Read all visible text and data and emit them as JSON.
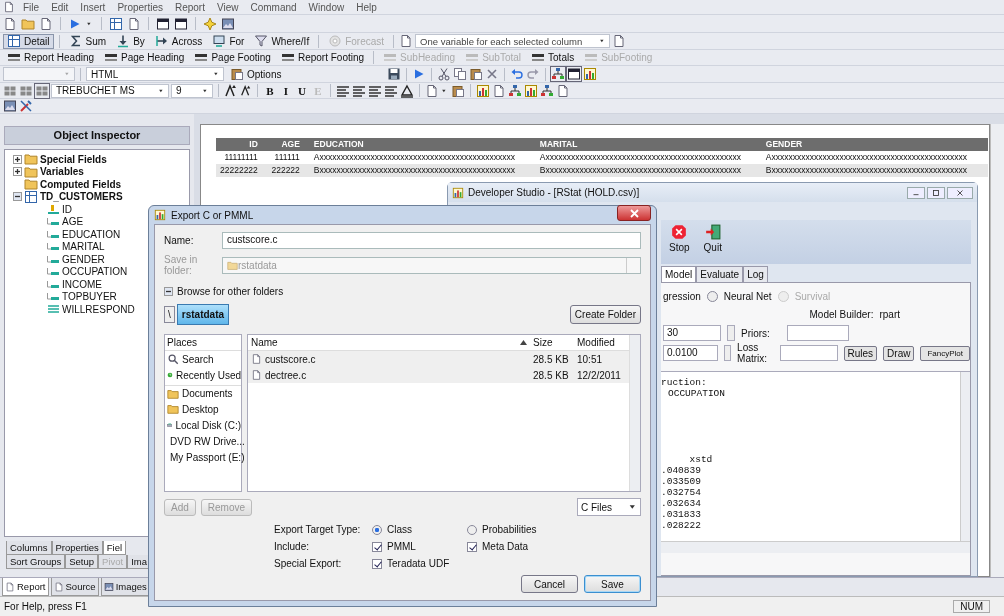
{
  "menu": [
    "File",
    "Edit",
    "Insert",
    "Properties",
    "Report",
    "View",
    "Command",
    "Window",
    "Help"
  ],
  "report_tools": [
    {
      "label": "Detail",
      "selected": true,
      "disabled": false
    },
    {
      "label": "Sum",
      "selected": false,
      "disabled": false
    },
    {
      "label": "By",
      "selected": false,
      "disabled": false
    },
    {
      "label": "Across",
      "selected": false,
      "disabled": false
    },
    {
      "label": "For",
      "selected": false,
      "disabled": false
    },
    {
      "label": "Where/If",
      "selected": false,
      "disabled": false
    },
    {
      "label": "Forecast",
      "selected": false,
      "disabled": true
    }
  ],
  "column_mode": "One variable for each selected column",
  "sections": [
    {
      "label": "Report Heading",
      "disabled": false
    },
    {
      "label": "Page Heading",
      "disabled": false
    },
    {
      "label": "Page Footing",
      "disabled": false
    },
    {
      "label": "Report Footing",
      "disabled": false
    },
    {
      "label": "SubHeading",
      "disabled": true
    },
    {
      "label": "SubTotal",
      "disabled": true
    },
    {
      "label": "Totals",
      "disabled": false
    },
    {
      "label": "SubFooting",
      "disabled": true
    }
  ],
  "output_format": "HTML",
  "options_button": "Options",
  "font": "TREBUCHET MS",
  "font_size": "9",
  "style_buttons": [
    {
      "label": "B",
      "disabled": false
    },
    {
      "label": "I",
      "disabled": false
    },
    {
      "label": "U",
      "disabled": false
    },
    {
      "label": "E",
      "disabled": true
    }
  ],
  "object_inspector": {
    "title": "Object Inspector",
    "tree": [
      {
        "label": "Special Fields",
        "kind": "folder",
        "has_toggle": true,
        "expanded": false
      },
      {
        "label": "Variables",
        "kind": "folder",
        "has_toggle": true,
        "expanded": false
      },
      {
        "label": "Computed Fields",
        "kind": "folder",
        "has_toggle": false
      },
      {
        "label": "TD_CUSTOMERS",
        "kind": "table",
        "has_toggle": true,
        "expanded": true,
        "children": [
          {
            "label": "ID",
            "kind": "key"
          },
          {
            "label": "AGE",
            "kind": "field"
          },
          {
            "label": "EDUCATION",
            "kind": "field"
          },
          {
            "label": "MARITAL",
            "kind": "field"
          },
          {
            "label": "GENDER",
            "kind": "field"
          },
          {
            "label": "OCCUPATION",
            "kind": "field"
          },
          {
            "label": "INCOME",
            "kind": "field"
          },
          {
            "label": "TOPBUYER",
            "kind": "field"
          },
          {
            "label": "WILLRESPOND",
            "kind": "computed"
          }
        ]
      }
    ],
    "tabs_row_1": [
      {
        "label": "Columns",
        "selected": false,
        "disabled": false
      },
      {
        "label": "Properties",
        "selected": false,
        "disabled": false
      },
      {
        "label": "Fiel",
        "selected": true,
        "disabled": false
      }
    ],
    "tabs_row_2": [
      {
        "label": "Sort Groups",
        "selected": false,
        "disabled": false
      },
      {
        "label": "Setup",
        "selected": false,
        "disabled": false
      },
      {
        "label": "Pivot",
        "selected": false,
        "disabled": true
      },
      {
        "label": "Ima",
        "selected": false,
        "disabled": false
      }
    ]
  },
  "report": {
    "columns": [
      "ID",
      "AGE",
      "EDUCATION",
      "MARITAL",
      "GENDER"
    ],
    "rows": [
      [
        "11111111",
        "111111",
        "Axxxxxxxxxxxxxxxxxxxxxxxxxxxxxxxxxxxxxxxxxxxxxx",
        "Axxxxxxxxxxxxxxxxxxxxxxxxxxxxxxxxxxxxxxxxxxxxxx",
        "Axxxxxxxxxxxxxxxxxxxxxxxxxxxxxxxxxxxxxxxxxxxxxx"
      ],
      [
        "22222222",
        "222222",
        "Bxxxxxxxxxxxxxxxxxxxxxxxxxxxxxxxxxxxxxxxxxxxxxx",
        "Bxxxxxxxxxxxxxxxxxxxxxxxxxxxxxxxxxxxxxxxxxxxxxx",
        "Bxxxxxxxxxxxxxxxxxxxxxxxxxxxxxxxxxxxxxxxxxxxxxx"
      ]
    ]
  },
  "doc_tabs": [
    {
      "label": "Report",
      "selected": true
    },
    {
      "label": "Source",
      "selected": false
    },
    {
      "label": "Images",
      "selected": false
    }
  ],
  "status_bar": {
    "help": "For Help, press F1",
    "num": "NUM"
  },
  "dev_studio": {
    "title": "Developer Studio - [RStat (HOLD.csv)]",
    "toolbar": [
      "Stop",
      "Quit"
    ],
    "tabs": [
      {
        "label": "Model",
        "selected": true
      },
      {
        "label": "Evaluate",
        "selected": false
      },
      {
        "label": "Log",
        "selected": false
      }
    ],
    "model_type_fragment": "gression",
    "model_types": [
      {
        "label": "Neural Net",
        "selected": false,
        "disabled": false
      },
      {
        "label": "Survival",
        "selected": false,
        "disabled": true
      }
    ],
    "model_builder_label": "Model Builder:",
    "model_builder": "rpart",
    "param_1": "30",
    "priors_label": "Priors:",
    "param_2": "0.0100",
    "loss_matrix_label": "Loss Matrix:",
    "buttons": [
      "Rules",
      "Draw",
      "FancyPlot"
    ],
    "output_lines": [
      "ruction:",
      "OCCUPATION"
    ],
    "output_header": "xstd",
    "output_values": [
      ".040839",
      ".033509",
      ".032754",
      ".032634",
      ".031833",
      ".028222"
    ]
  },
  "dialog": {
    "title": "Export C or PMML",
    "name_label": "Name:",
    "name_value": "custscore.c",
    "folder_label": "Save in folder:",
    "folder_value": "rstatdata",
    "browse": "Browse for other folders",
    "browse_expanded": true,
    "path": [
      {
        "label": "\\",
        "selected": false
      },
      {
        "label": "rstatdata",
        "selected": true
      }
    ],
    "create_folder": "Create Folder",
    "places_title": "Places",
    "places": [
      {
        "label": "Search",
        "kind": "search"
      },
      {
        "label": "Recently Used",
        "kind": "recent"
      },
      {
        "label": "Documents",
        "kind": "folder"
      },
      {
        "label": "Desktop",
        "kind": "folder"
      },
      {
        "label": "Local Disk (C:)",
        "kind": "disk"
      },
      {
        "label": "DVD RW Drive...",
        "kind": "dvd"
      },
      {
        "label": "My Passport (E:)",
        "kind": "drive"
      }
    ],
    "file_columns": [
      {
        "label": "Name",
        "sorted": true
      },
      {
        "label": "Size",
        "sorted": false
      },
      {
        "label": "Modified",
        "sorted": false
      }
    ],
    "files": [
      {
        "name": "custscore.c",
        "size": "28.5 KB",
        "modified": "10:51"
      },
      {
        "name": "dectree.c",
        "size": "28.5 KB",
        "modified": "12/2/2011"
      }
    ],
    "place_buttons": [
      {
        "label": "Add",
        "disabled": true
      },
      {
        "label": "Remove",
        "disabled": true
      }
    ],
    "filter": "C Files",
    "options": [
      {
        "label": "Export Target Type:",
        "choices": [
          {
            "label": "Class",
            "kind": "radio",
            "on": true
          },
          {
            "label": "Probabilities",
            "kind": "radio",
            "on": false
          }
        ]
      },
      {
        "label": "Include:",
        "choices": [
          {
            "label": "PMML",
            "kind": "checkbox",
            "on": true
          },
          {
            "label": "Meta Data",
            "kind": "checkbox",
            "on": true
          }
        ]
      },
      {
        "label": "Special Export:",
        "choices": [
          {
            "label": "Teradata UDF",
            "kind": "checkbox",
            "on": true
          }
        ]
      }
    ],
    "buttons": [
      {
        "label": "Cancel",
        "default": false
      },
      {
        "label": "Save",
        "default": true
      }
    ]
  }
}
